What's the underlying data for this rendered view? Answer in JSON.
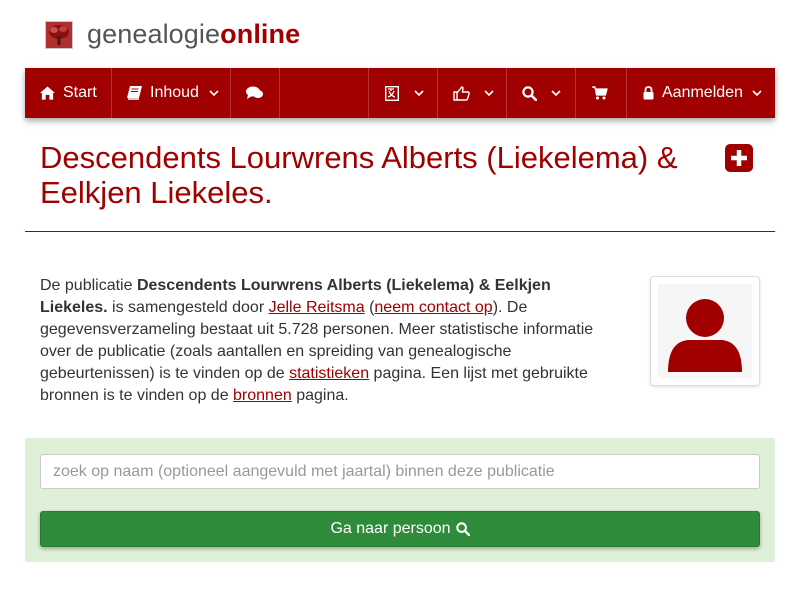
{
  "brand": {
    "name_part1": "genealogie",
    "name_part2": "online"
  },
  "nav": {
    "start_label": "Start",
    "contents_label": "Inhoud",
    "login_label": "Aanmelden",
    "icons": [
      "home-icon",
      "book-icon",
      "comments-icon",
      "translate-icon",
      "thumbs-up-icon",
      "search-icon",
      "cart-icon",
      "lock-icon"
    ]
  },
  "page": {
    "title": "Descendents Lourwrens Alberts (Liekelema) & Eelkjen Liekeles."
  },
  "intro": {
    "t1": "De publicatie ",
    "pub_title": "Descendents Lourwrens Alberts (Liekelema) & Eelkjen Liekeles.",
    "t2": " is samengesteld door ",
    "author": "Jelle Reitsma",
    "t3": " (",
    "contact": "neem contact op",
    "t4": "). De gegevensverzameling bestaat uit 5.728 personen. Meer statistische informatie over de publicatie (zoals aantallen en spreiding van genealogische gebeurtenissen) is te vinden op de ",
    "stats": "statistieken",
    "t5": " pagina. Een lijst met gebruikte bronnen is te vinden op de ",
    "sources": "bronnen",
    "t6": " pagina."
  },
  "search": {
    "placeholder": "zoek op naam (optioneel aangevuld met jaartal) binnen deze publicatie",
    "button_label": "Ga naar persoon"
  },
  "colors": {
    "brand_red": "#a00000",
    "panel_green": "#dff0d8",
    "button_green": "#2e8b3a"
  }
}
